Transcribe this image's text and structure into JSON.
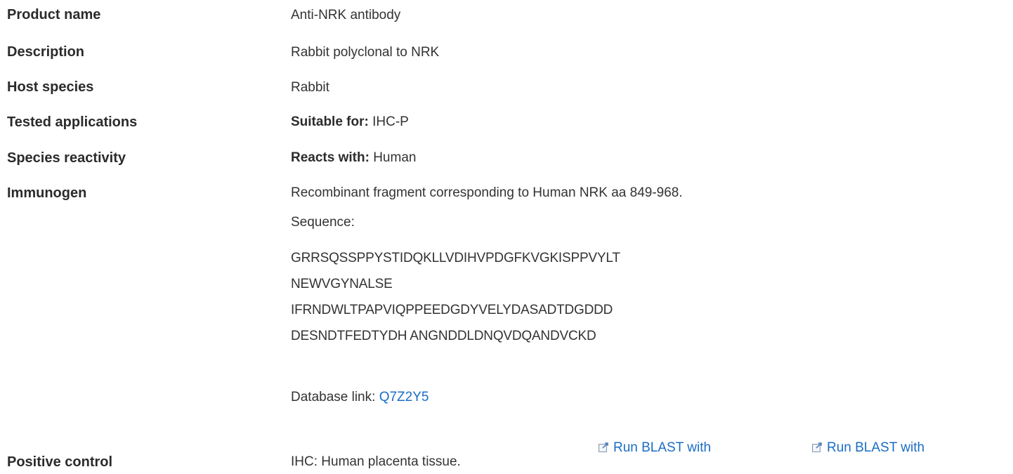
{
  "rows": {
    "product_name": {
      "label": "Product name",
      "value": "Anti-NRK antibody"
    },
    "description": {
      "label": "Description",
      "value": "Rabbit polyclonal to NRK"
    },
    "host_species": {
      "label": "Host species",
      "value": "Rabbit"
    },
    "tested_applications": {
      "label": "Tested applications",
      "prefix": "Suitable for:",
      "value": "IHC-P"
    },
    "species_reactivity": {
      "label": "Species reactivity",
      "prefix": "Reacts with:",
      "value": "Human"
    },
    "immunogen": {
      "label": "Immunogen",
      "description": "Recombinant fragment corresponding to Human NRK aa 849-968.",
      "sequence_label": "Sequence:",
      "sequence_lines": [
        "GRRSQSSPPYSTIDQKLLVDIHVPDGFKVGKISPPVYLT",
        "NEWVGYNALSE",
        "IFRNDWLTPAPVIQPPEEDGDYVELYDASADTDGDDD",
        "DESNDTFEDTYDH ANGNDDLDNQVDQANDVCKD"
      ],
      "database_link_label": "Database link:",
      "database_link_value": "Q7Z2Y5",
      "blast_buttons": [
        "Run BLAST with",
        "Run BLAST with"
      ]
    },
    "positive_control": {
      "label": "Positive control",
      "value": "IHC: Human placenta tissue."
    }
  },
  "colors": {
    "link": "#1a6dc6",
    "text": "#333333"
  },
  "icons": [
    "external-blast-icon"
  ]
}
